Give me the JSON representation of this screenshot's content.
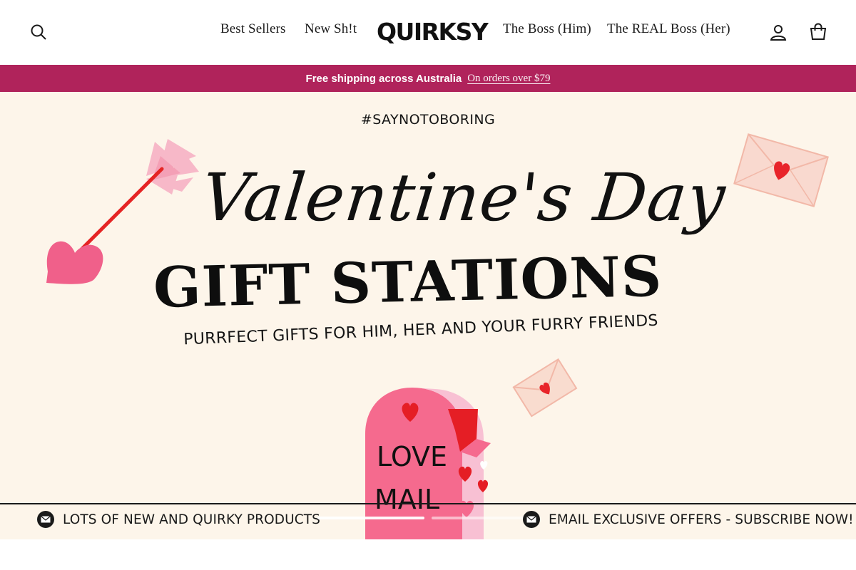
{
  "header": {
    "logo_text": "QUIRKSY",
    "nav": [
      {
        "label": "Best Sellers"
      },
      {
        "label": "New Sh!t"
      },
      {
        "label": "The Boss (Him)"
      },
      {
        "label": "The REAL Boss (Her)"
      }
    ],
    "icons": [
      "search-icon",
      "account-icon",
      "cart-icon"
    ]
  },
  "announcement": {
    "strong": "Free shipping across Australia",
    "link": "On orders over $79",
    "background": "#b0235b"
  },
  "hero": {
    "hashtag": "#SAYNOTOBORING",
    "script_title": "Valentine's Day",
    "title": "GIFT STATIONS",
    "subtitle": "PURRFECT GIFTS FOR HIM, HER AND YOUR FURRY FRIENDS",
    "mailbox_text": [
      "LOVE",
      "MAIL"
    ],
    "strip_left": "LOTS OF NEW AND QUIRKY PRODUCTS",
    "strip_right": "EMAIL EXCLUSIVE OFFERS - SUBSCRIBE NOW!",
    "background": "#fdf5ea",
    "slides": [
      {
        "active": true
      },
      {
        "active": false
      }
    ]
  }
}
